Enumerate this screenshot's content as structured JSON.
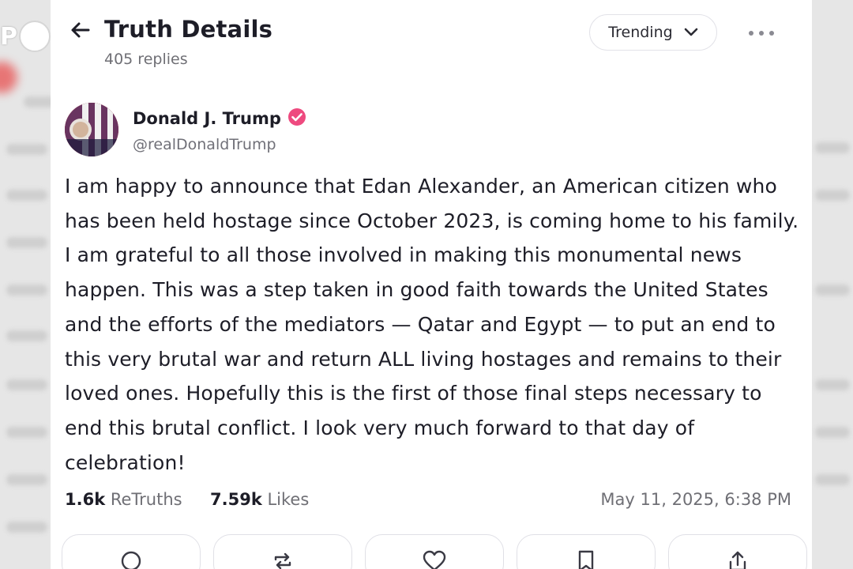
{
  "overlay": {
    "logo_letter": "P"
  },
  "header": {
    "title": "Truth Details",
    "replies": "405 replies",
    "sort_label": "Trending"
  },
  "post": {
    "author_name": "Donald J. Trump",
    "author_handle": "@realDonaldTrump",
    "verified": true,
    "body": "I am happy to announce that Edan Alexander, an American citizen who has been held hostage since October 2023, is coming home to his family. I am grateful to all those involved in making this monumental news happen. This was a step taken in good faith towards the United States and the efforts of the mediators — Qatar and Egypt — to put an end to this very brutal war and return ALL living hostages and remains to their loved ones. Hopefully this is the first of those final steps necessary to end this brutal conflict. I look very much forward to that day of celebration!",
    "retruths_count": "1.6k",
    "retruths_label": "ReTruths",
    "likes_count": "7.59k",
    "likes_label": "Likes",
    "timestamp": "May 11, 2025, 6:38 PM"
  },
  "actions": [
    {
      "icon": "reply-icon"
    },
    {
      "icon": "retruth-icon"
    },
    {
      "icon": "heart-icon"
    },
    {
      "icon": "bookmark-icon"
    },
    {
      "icon": "share-icon"
    }
  ],
  "colors": {
    "verified": "#ee4a7f",
    "accent": "#5448ee",
    "text": "#1d1d27",
    "muted": "#6f6f75"
  }
}
